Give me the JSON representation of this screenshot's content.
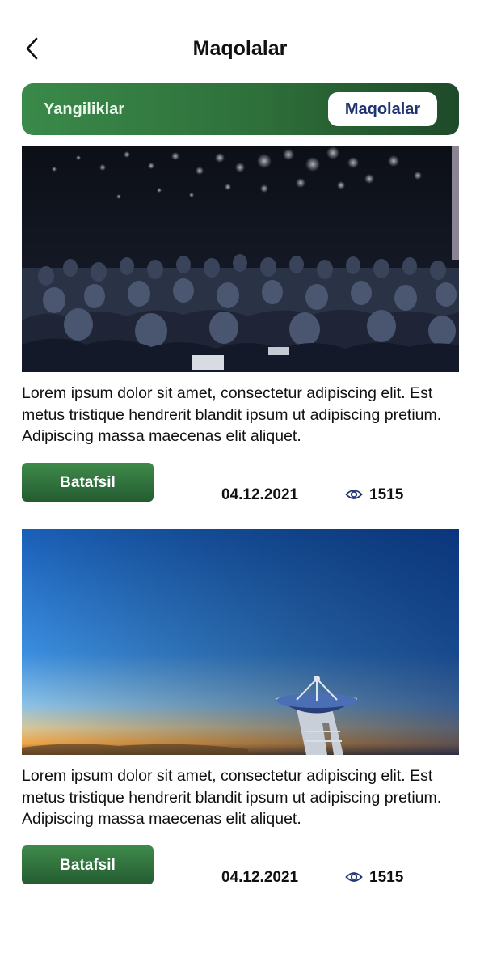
{
  "header": {
    "title": "Maqolalar",
    "back_icon": "chevron-left-icon"
  },
  "tabs": [
    {
      "label": "Yangiliklar",
      "active": false
    },
    {
      "label": "Maqolalar",
      "active": true
    }
  ],
  "colors": {
    "accent_green": "#2e6f3a",
    "active_tab_text": "#1f3470"
  },
  "articles": [
    {
      "image": "conference-audience-photo",
      "text": "Lorem ipsum dolor sit amet, consectetur adipiscing elit. Est metus tristique hendrerit blandit ipsum ut adipiscing pretium. Adipiscing massa maecenas elit aliquet.",
      "button_label": "Batafsil",
      "date": "04.12.2021",
      "views": "1515",
      "views_icon": "eye-icon"
    },
    {
      "image": "radio-telescope-sky-photo",
      "text": "Lorem ipsum dolor sit amet, consectetur adipiscing elit. Est metus tristique hendrerit blandit ipsum ut adipiscing pretium. Adipiscing massa maecenas elit aliquet.",
      "button_label": "Batafsil",
      "date": "04.12.2021",
      "views": "1515",
      "views_icon": "eye-icon"
    }
  ]
}
